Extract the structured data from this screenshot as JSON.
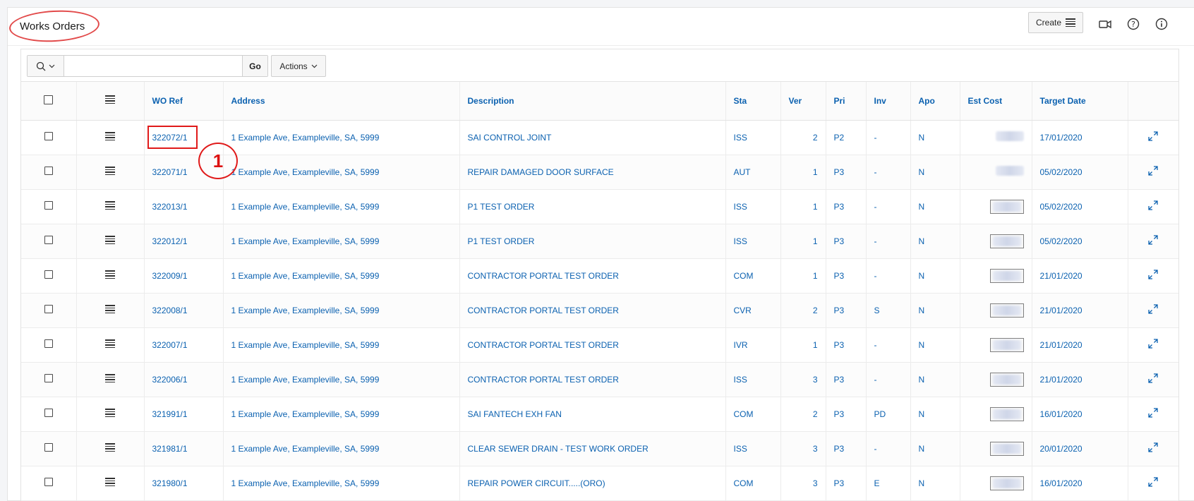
{
  "region": {
    "title": "Works Orders",
    "create_label": "Create"
  },
  "toolbar": {
    "search_placeholder": "",
    "go_label": "Go",
    "actions_label": "Actions"
  },
  "columns": [
    "WO Ref",
    "Address",
    "Description",
    "Sta",
    "Ver",
    "Pri",
    "Inv",
    "Apo",
    "Est Cost",
    "Target Date"
  ],
  "rows": [
    {
      "ref": "322072/1",
      "address": "1 Example Ave, Exampleville, SA, 5999",
      "desc": "SAI CONTROL JOINT",
      "sta": "ISS",
      "ver": "2",
      "pri": "P2",
      "inv": "-",
      "apo": "N",
      "cost_style": "plain",
      "date": "17/01/2020"
    },
    {
      "ref": "322071/1",
      "address": "1 Example Ave, Exampleville, SA, 5999",
      "desc": "REPAIR DAMAGED DOOR SURFACE",
      "sta": "AUT",
      "ver": "1",
      "pri": "P3",
      "inv": "-",
      "apo": "N",
      "cost_style": "plain",
      "date": "05/02/2020"
    },
    {
      "ref": "322013/1",
      "address": "1 Example Ave, Exampleville, SA, 5999",
      "desc": "P1 TEST ORDER",
      "sta": "ISS",
      "ver": "1",
      "pri": "P3",
      "inv": "-",
      "apo": "N",
      "cost_style": "boxed",
      "date": "05/02/2020"
    },
    {
      "ref": "322012/1",
      "address": "1 Example Ave, Exampleville, SA, 5999",
      "desc": "P1 TEST ORDER",
      "sta": "ISS",
      "ver": "1",
      "pri": "P3",
      "inv": "-",
      "apo": "N",
      "cost_style": "boxed",
      "date": "05/02/2020"
    },
    {
      "ref": "322009/1",
      "address": "1 Example Ave, Exampleville, SA, 5999",
      "desc": "CONTRACTOR PORTAL TEST ORDER",
      "sta": "COM",
      "ver": "1",
      "pri": "P3",
      "inv": "-",
      "apo": "N",
      "cost_style": "boxed",
      "date": "21/01/2020"
    },
    {
      "ref": "322008/1",
      "address": "1 Example Ave, Exampleville, SA, 5999",
      "desc": "CONTRACTOR PORTAL TEST ORDER",
      "sta": "CVR",
      "ver": "2",
      "pri": "P3",
      "inv": "S",
      "apo": "N",
      "cost_style": "boxed",
      "date": "21/01/2020"
    },
    {
      "ref": "322007/1",
      "address": "1 Example Ave, Exampleville, SA, 5999",
      "desc": "CONTRACTOR PORTAL TEST ORDER",
      "sta": "IVR",
      "ver": "1",
      "pri": "P3",
      "inv": "-",
      "apo": "N",
      "cost_style": "boxed",
      "date": "21/01/2020"
    },
    {
      "ref": "322006/1",
      "address": "1 Example Ave, Exampleville, SA, 5999",
      "desc": "CONTRACTOR PORTAL TEST ORDER",
      "sta": "ISS",
      "ver": "3",
      "pri": "P3",
      "inv": "-",
      "apo": "N",
      "cost_style": "boxed",
      "date": "21/01/2020"
    },
    {
      "ref": "321991/1",
      "address": "1 Example Ave, Exampleville, SA, 5999",
      "desc": "SAI FANTECH EXH FAN",
      "sta": "COM",
      "ver": "2",
      "pri": "P3",
      "inv": "PD",
      "apo": "N",
      "cost_style": "boxed",
      "date": "16/01/2020"
    },
    {
      "ref": "321981/1",
      "address": "1 Example Ave, Exampleville, SA, 5999",
      "desc": "CLEAR SEWER DRAIN - TEST WORK ORDER",
      "sta": "ISS",
      "ver": "3",
      "pri": "P3",
      "inv": "-",
      "apo": "N",
      "cost_style": "boxed",
      "date": "20/01/2020"
    },
    {
      "ref": "321980/1",
      "address": "1 Example Ave, Exampleville, SA, 5999",
      "desc": "REPAIR POWER CIRCUIT.....(ORO)",
      "sta": "COM",
      "ver": "3",
      "pri": "P3",
      "inv": "E",
      "apo": "N",
      "cost_style": "boxed",
      "date": "16/01/2020"
    }
  ],
  "annotation": {
    "number": "1"
  }
}
